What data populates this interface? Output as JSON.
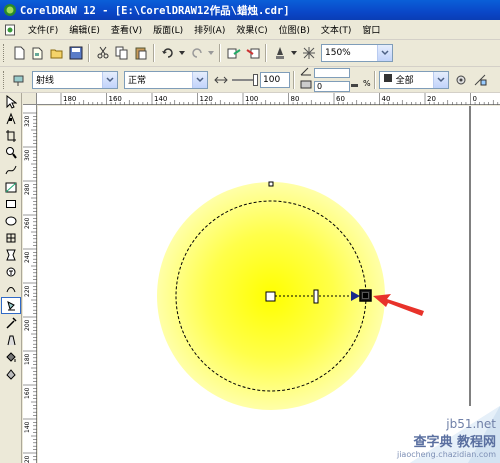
{
  "window": {
    "title": "CorelDRAW 12 - [E:\\CorelDRAW12作品\\蜡烛.cdr]"
  },
  "menu": {
    "items": [
      {
        "label": "文件(F)"
      },
      {
        "label": "编辑(E)"
      },
      {
        "label": "查看(V)"
      },
      {
        "label": "版面(L)"
      },
      {
        "label": "排列(A)"
      },
      {
        "label": "效果(C)"
      },
      {
        "label": "位图(B)"
      },
      {
        "label": "文本(T)"
      },
      {
        "label": "窗口"
      }
    ]
  },
  "standard_toolbar": {
    "zoom_value": "150%"
  },
  "property_bar": {
    "fill_type": "射线",
    "blend_mode": "正常",
    "midpoint_value": "100",
    "angle_value": "0",
    "edge_pad_value": "0",
    "percent_sign": "%",
    "apply_to": "全部"
  },
  "rulers": {
    "horizontal_ticks": [
      "180",
      "160",
      "140",
      "120",
      "100",
      "80",
      "60",
      "40",
      "20",
      "0"
    ],
    "vertical_ticks": [
      "320",
      "300",
      "280",
      "260",
      "240",
      "220",
      "200",
      "180",
      "160",
      "140",
      "120"
    ]
  },
  "colors": {
    "title_bar": "#0a47c8",
    "flame_center": "#ffff00",
    "flame_edge": "#ffffa8",
    "arrow_annotation": "#e8322a",
    "watermark": "#5a6fa0"
  },
  "watermark": {
    "line1": "jb51.net",
    "line2": "查字典 教程网",
    "line3": "jiaocheng.chazidian.com"
  }
}
